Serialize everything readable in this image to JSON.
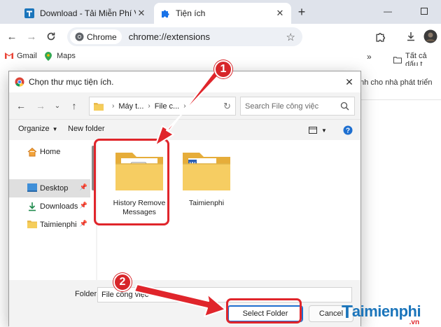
{
  "browser": {
    "tabs": [
      {
        "title": "Download - Tải Miễn Phí VN - P",
        "active": false,
        "favicon": "taimienphi-t-icon"
      },
      {
        "title": "Tiện ích",
        "active": true,
        "favicon": "puzzle-icon"
      }
    ],
    "omnibox": {
      "chip_label": "Chrome",
      "url": "chrome://extensions"
    },
    "bookmarks": [
      {
        "label": "Gmail",
        "icon": "gmail-icon"
      },
      {
        "label": "Maps",
        "icon": "maps-icon"
      }
    ],
    "all_bookmarks_label": "Tất cả dấu t",
    "page_partial_text": "ành cho nhà phát triển"
  },
  "dialog": {
    "title": "Chọn thư mục tiện ích.",
    "breadcrumb": [
      "Máy t...",
      "File c..."
    ],
    "search_placeholder": "Search File công việc",
    "organize_label": "Organize",
    "new_folder_label": "New folder",
    "nav_items": [
      {
        "label": "Home",
        "icon": "home-icon",
        "pinned": false,
        "selected": false
      },
      {
        "label": "Desktop",
        "icon": "desktop-icon",
        "pinned": true,
        "selected": true
      },
      {
        "label": "Downloads",
        "icon": "download-icon",
        "pinned": true,
        "selected": false
      },
      {
        "label": "Taimienphi",
        "icon": "folder-icon",
        "pinned": true,
        "selected": false
      }
    ],
    "folders": [
      {
        "label_line1": "History Remove",
        "label_line2": "Messages"
      },
      {
        "label_line1": "Taimienphi",
        "label_line2": ""
      }
    ],
    "folder_field_label": "Folder:",
    "folder_field_value": "File công việc",
    "select_button": "Select Folder",
    "cancel_button": "Cancel"
  },
  "annotations": {
    "step1": "1",
    "step2": "2"
  },
  "watermark": {
    "main": "aimienphi",
    "initial": "T",
    "tld": ".vn"
  },
  "colors": {
    "accent_red": "#d7262a",
    "select_border": "#1e6fd0",
    "brand_blue": "#1b75bb"
  }
}
